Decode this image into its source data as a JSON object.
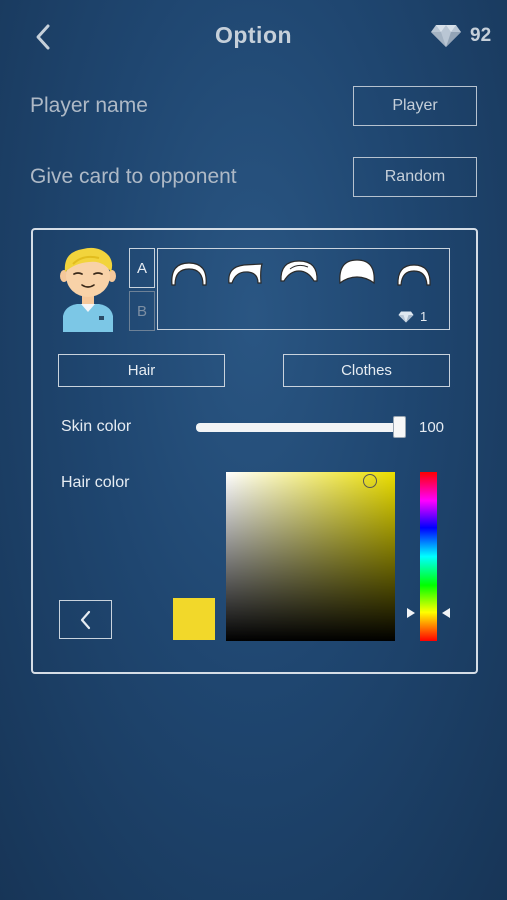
{
  "header": {
    "title": "Option",
    "back_icon": "chevron-left-icon",
    "gem_icon": "diamond-icon",
    "gem_count": "92"
  },
  "settings": {
    "player_name_label": "Player name",
    "player_name_value": "Player",
    "give_card_label": "Give card to opponent",
    "give_card_value": "Random"
  },
  "editor": {
    "avatar_icon": "boy-avatar-icon",
    "slot_a": "A",
    "slot_b": "B",
    "hair_styles": [
      "hair-style-1",
      "hair-style-2",
      "hair-style-3",
      "hair-style-4",
      "hair-style-5"
    ],
    "hair_price": "1",
    "tabs": [
      "Hair",
      "Clothes"
    ],
    "skin_color_label": "Skin color",
    "skin_color_value": "100",
    "skin_color_level": 1.0,
    "hair_color_label": "Hair color",
    "hair_color_hex": "#f2d82a",
    "picker_hue_color": "#ebde00"
  }
}
